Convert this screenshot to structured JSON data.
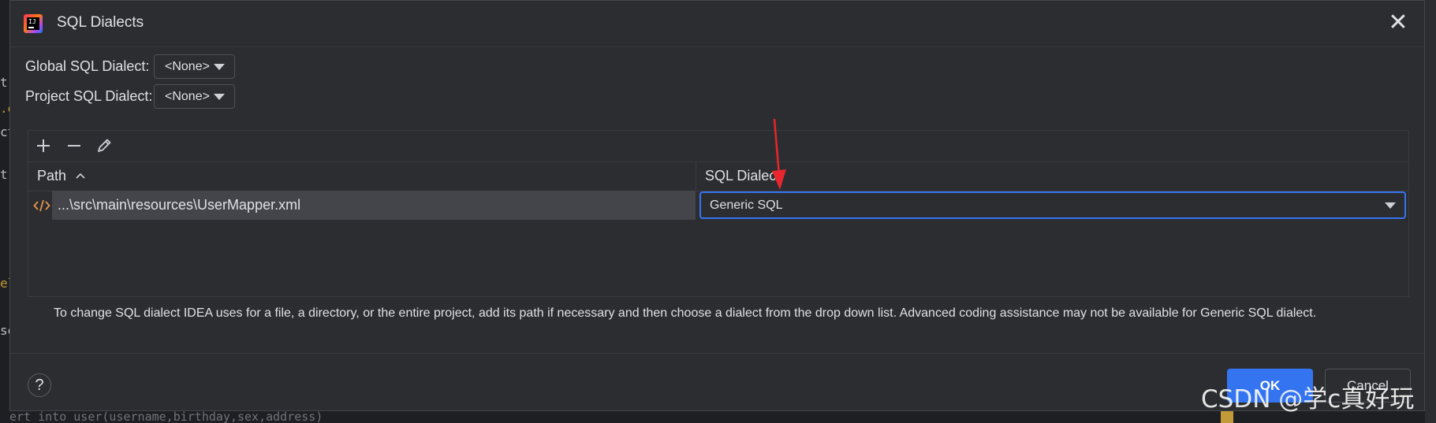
{
  "dialog": {
    "title": "SQL Dialects",
    "close_glyph": "✕"
  },
  "global": {
    "label": "Global SQL Dialect:",
    "value": "<None>"
  },
  "project": {
    "label": "Project SQL Dialect:",
    "value": "<None>"
  },
  "toolbar": {
    "add_icon": "plus-icon",
    "remove_icon": "minus-icon",
    "edit_icon": "pencil-icon"
  },
  "table": {
    "columns": [
      {
        "label": "Path",
        "sort": "ascending"
      },
      {
        "label": "SQL Dialect"
      }
    ],
    "rows": [
      {
        "icon": "xml-file-icon",
        "path": "...\\src\\main\\resources\\UserMapper.xml",
        "dialect": "Generic SQL"
      }
    ]
  },
  "hint": "To change SQL dialect IDEA uses for a file, a directory, or the entire project, add its path if necessary and then choose a dialect from the drop down list. Advanced coding assistance may not be available for Generic SQL dialect.",
  "footer": {
    "help": "?",
    "ok": "OK",
    "cancel": "Cancel"
  },
  "watermark": "CSDN @学c真好玩",
  "colors": {
    "accent": "#3574f0",
    "annotation_arrow": "#e8262d"
  }
}
